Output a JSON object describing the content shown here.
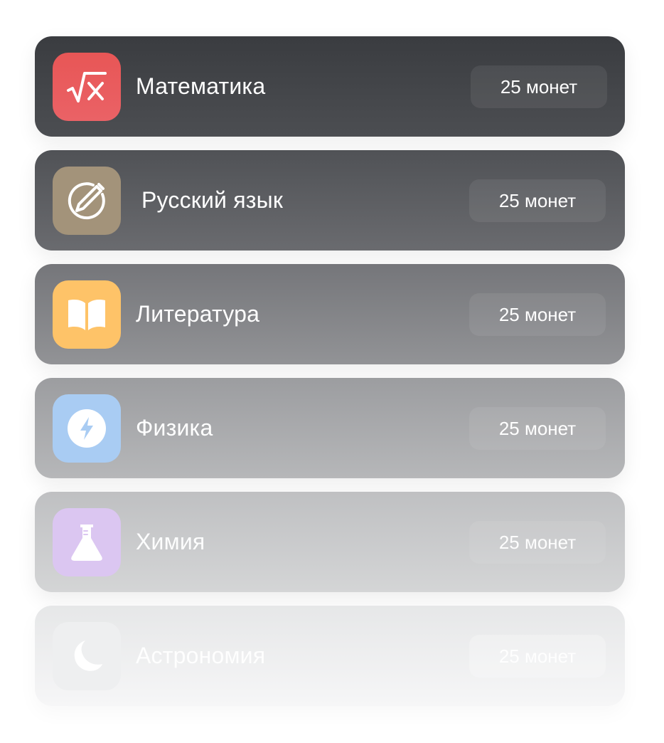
{
  "subjects": [
    {
      "title": "Математика",
      "price": "25 монет",
      "icon": "square-root-icon",
      "icon_color": "#e85656"
    },
    {
      "title": "Русский язык",
      "price": "25 монет",
      "icon": "pencil-circle-icon",
      "icon_color": "#a3937a"
    },
    {
      "title": "Литература",
      "price": "25 монет",
      "icon": "open-book-icon",
      "icon_color": "#fec368"
    },
    {
      "title": "Физика",
      "price": "25 монет",
      "icon": "lightning-icon",
      "icon_color": "#a9ccf3"
    },
    {
      "title": "Химия",
      "price": "25 монет",
      "icon": "flask-icon",
      "icon_color": "#dbc6f1"
    },
    {
      "title": "Астрономия",
      "price": "25 монет",
      "icon": "moon-icon",
      "icon_color": "#eeeff0"
    }
  ]
}
